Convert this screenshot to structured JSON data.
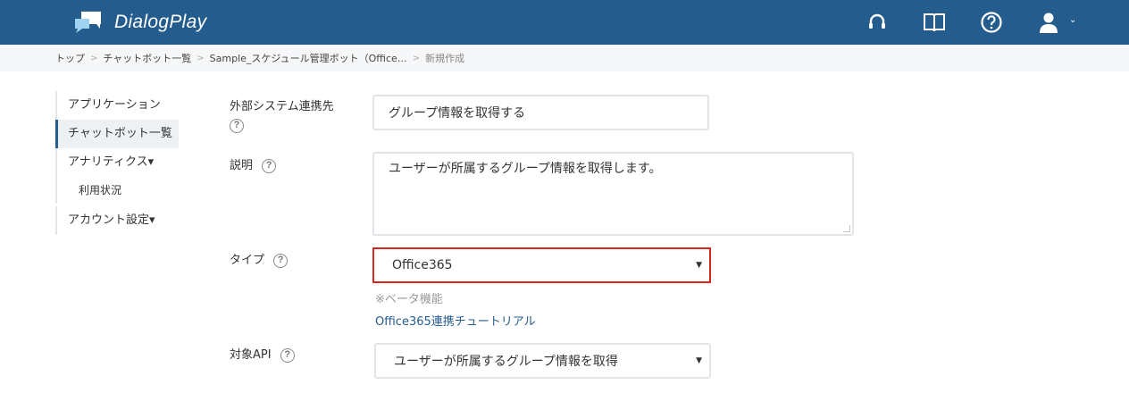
{
  "app": {
    "title": "DialogPlay"
  },
  "header": {
    "icons": [
      "headset-icon",
      "book-icon",
      "question-icon",
      "user-icon"
    ],
    "brand_color": "#245c8d"
  },
  "breadcrumb": {
    "items": [
      "トップ",
      "チャットボット一覧",
      "Sample_スケジュール管理ボット（Office…",
      "新規作成"
    ],
    "separator": ">"
  },
  "sidebar": {
    "items": [
      {
        "label": "アプリケーション"
      },
      {
        "label": "チャットボット一覧",
        "active": true
      },
      {
        "label": "アナリティクス▾"
      },
      {
        "label": "利用状況"
      },
      {
        "label": "アカウント設定▾"
      }
    ]
  },
  "form": {
    "external_system": {
      "label": "外部システム連携先",
      "value": "グループ情報を取得する"
    },
    "description": {
      "label": "説明",
      "value": "ユーザーが所属するグループ情報を取得します。"
    },
    "type": {
      "label": "タイプ",
      "value": "Office365",
      "note": "※ベータ機能",
      "tutorial_link": "Office365連携チュートリアル",
      "highlight_color": "#d9261c"
    },
    "target_api": {
      "label": "対象API",
      "value": "ユーザーが所属するグループ情報を取得"
    }
  }
}
